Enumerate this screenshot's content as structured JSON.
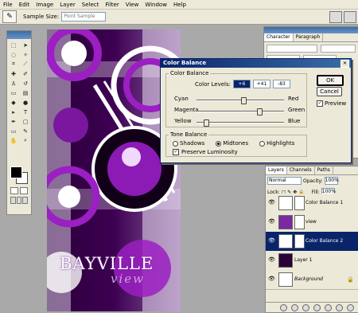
{
  "menu": [
    "File",
    "Edit",
    "Image",
    "Layer",
    "Select",
    "Filter",
    "View",
    "Window",
    "Help"
  ],
  "options": {
    "sample_size_label": "Sample Size:",
    "sample_size_value": "Point Sample"
  },
  "document": {
    "title": "BAYVILLE",
    "subtitle": "view"
  },
  "character_panel": {
    "tabs": [
      "Character",
      "Paragraph"
    ]
  },
  "dialog": {
    "title": "Color Balance",
    "group1": "Color Balance",
    "levels_label": "Color Levels:",
    "levels": [
      "+6",
      "+41",
      "-83"
    ],
    "sliders": [
      {
        "left": "Cyan",
        "right": "Red",
        "value": 6
      },
      {
        "left": "Magenta",
        "right": "Green",
        "value": 41
      },
      {
        "left": "Yellow",
        "right": "Blue",
        "value": -83
      }
    ],
    "group2": "Tone Balance",
    "tones": [
      "Shadows",
      "Midtones",
      "Highlights"
    ],
    "selected_tone": "Midtones",
    "preserve": "Preserve Luminosity",
    "ok": "OK",
    "cancel": "Cancel",
    "preview": "Preview"
  },
  "layers": {
    "tabs": [
      "Layers",
      "Channels",
      "Paths"
    ],
    "blend": "Normal",
    "opacity_label": "Opacity:",
    "opacity": "100%",
    "lock_label": "Lock:",
    "fill_label": "Fill:",
    "fill": "100%",
    "items": [
      {
        "name": "Color Balance 1",
        "active": false,
        "italic": false
      },
      {
        "name": "view",
        "active": false,
        "italic": false
      },
      {
        "name": "Color Balance 2",
        "active": true,
        "italic": false
      },
      {
        "name": "Layer 1",
        "active": false,
        "italic": false
      },
      {
        "name": "Background",
        "active": false,
        "italic": true
      }
    ]
  }
}
